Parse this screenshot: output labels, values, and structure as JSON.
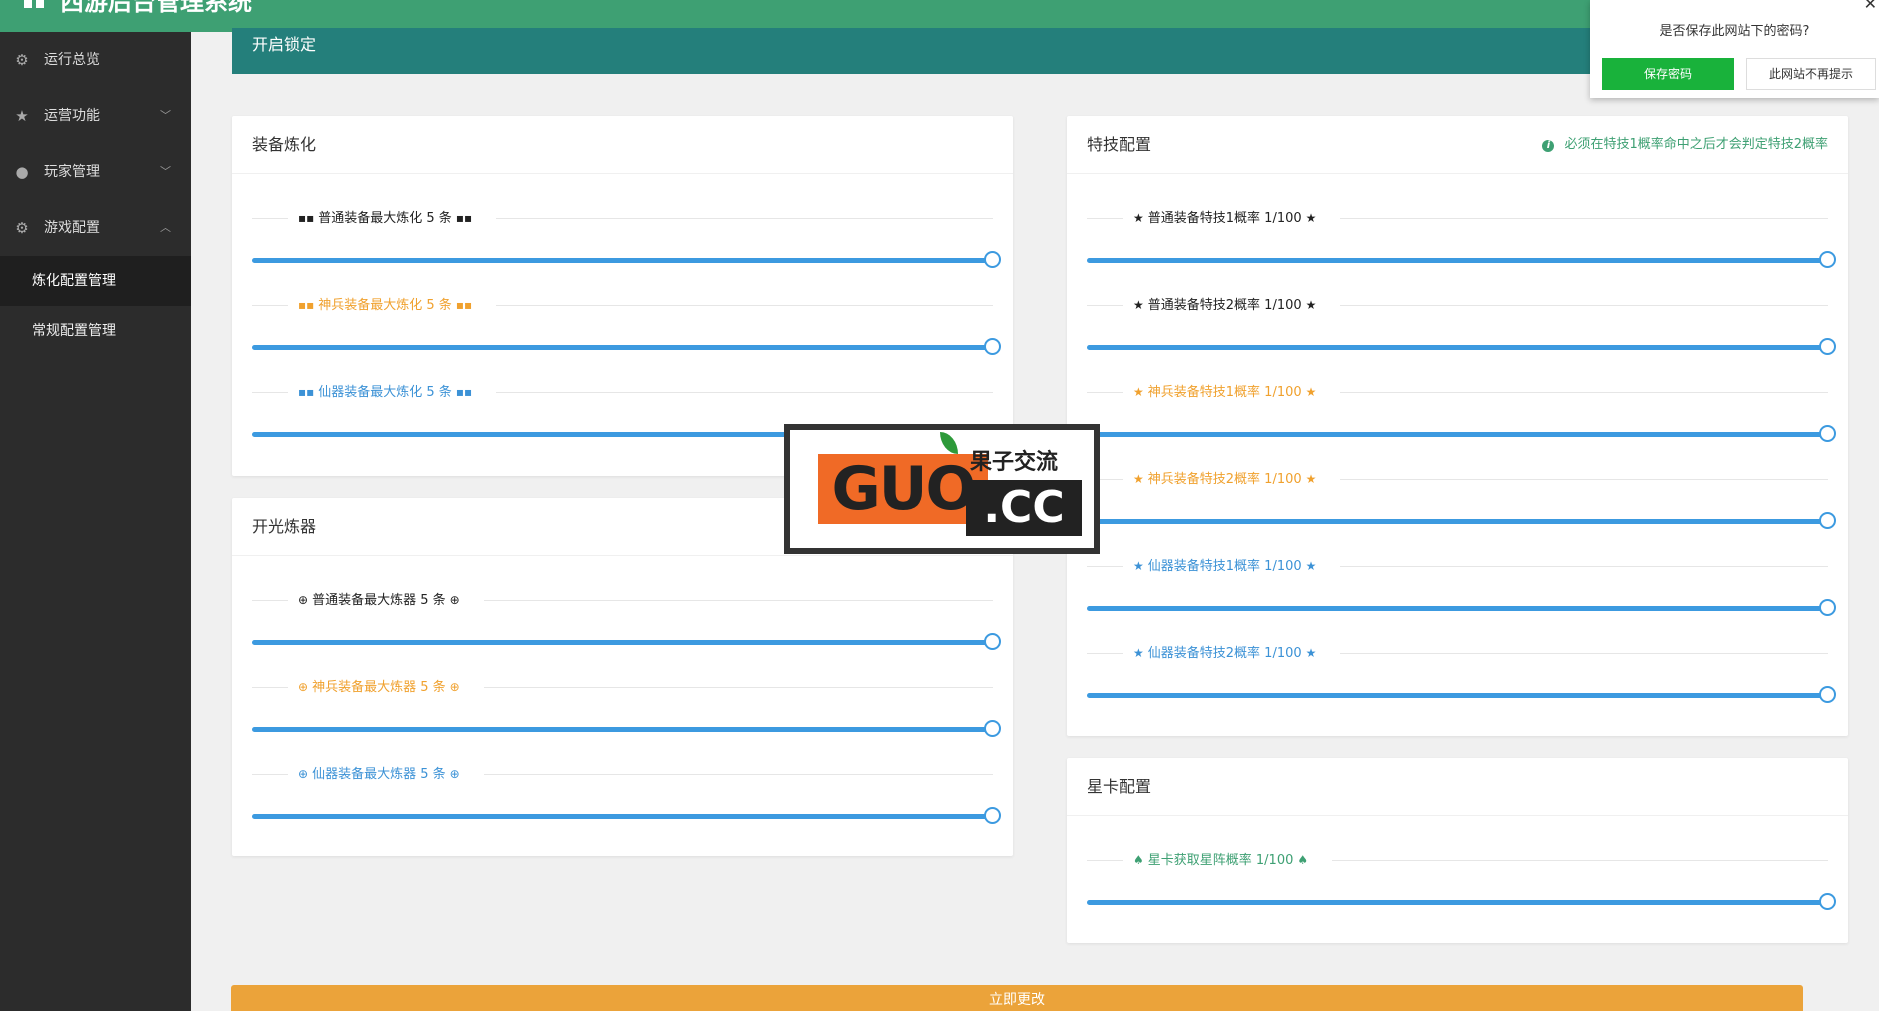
{
  "app": {
    "title": "西游后台管理系统"
  },
  "sidebar": {
    "items": [
      {
        "label": "运行总览",
        "icon": "settings-ring-icon",
        "has_children": false
      },
      {
        "label": "运营功能",
        "icon": "star-icon",
        "has_children": true
      },
      {
        "label": "玩家管理",
        "icon": "user-icon",
        "has_children": true
      },
      {
        "label": "游戏配置",
        "icon": "gear-icon",
        "has_children": true,
        "expanded": true
      }
    ],
    "subitems": [
      {
        "label": "炼化配置管理",
        "active": true
      },
      {
        "label": "常规配置管理",
        "active": false
      }
    ]
  },
  "lock_bar": {
    "label": "开启锁定"
  },
  "refine_card": {
    "title": "装备炼化",
    "rows": [
      {
        "label": "普通装备最大炼化 5 条",
        "color": "#222222",
        "icon": "grid-icon",
        "value": 5,
        "max": 5
      },
      {
        "label": "神兵装备最大炼化 5 条",
        "color": "#f0a12e",
        "icon": "grid-icon",
        "value": 5,
        "max": 5
      },
      {
        "label": "仙器装备最大炼化 5 条",
        "color": "#3c92d6",
        "icon": "grid-icon",
        "value": 5,
        "max": 5
      }
    ]
  },
  "forge_card": {
    "title": "开光炼器",
    "rows": [
      {
        "label": "普通装备最大炼器 5 条",
        "color": "#222222",
        "icon": "plus-circle-icon",
        "value": 5,
        "max": 5
      },
      {
        "label": "神兵装备最大炼器 5 条",
        "color": "#f0a12e",
        "icon": "plus-circle-icon",
        "value": 5,
        "max": 5
      },
      {
        "label": "仙器装备最大炼器 5 条",
        "color": "#3c92d6",
        "icon": "plus-circle-icon",
        "value": 5,
        "max": 5
      }
    ]
  },
  "skill_card": {
    "title": "特技配置",
    "hint": "必须在特技1概率命中之后才会判定特技2概率",
    "rows": [
      {
        "label": "普通装备特技1概率 1/100",
        "color": "#222222",
        "icon": "star-icon",
        "value": 100,
        "max": 100
      },
      {
        "label": "普通装备特技2概率 1/100",
        "color": "#222222",
        "icon": "star-icon",
        "value": 100,
        "max": 100
      },
      {
        "label": "神兵装备特技1概率 1/100",
        "color": "#f0a12e",
        "icon": "star-icon",
        "value": 100,
        "max": 100
      },
      {
        "label": "神兵装备特技2概率 1/100",
        "color": "#f0a12e",
        "icon": "star-icon",
        "value": 100,
        "max": 100
      },
      {
        "label": "仙器装备特技1概率 1/100",
        "color": "#3c92d6",
        "icon": "star-icon",
        "value": 100,
        "max": 100
      },
      {
        "label": "仙器装备特技2概率 1/100",
        "color": "#3c92d6",
        "icon": "star-icon",
        "value": 100,
        "max": 100
      }
    ]
  },
  "star_card": {
    "title": "星卡配置",
    "rows": [
      {
        "label": "星卡获取星阵概率 1/100",
        "color": "#3ea073",
        "icon": "bell-icon",
        "value": 100,
        "max": 100
      }
    ]
  },
  "submit": {
    "label": "立即更改"
  },
  "password_popup": {
    "title": "是否保存此网站下的密码?",
    "save_label": "保存密码",
    "never_label": "此网站不再提示"
  },
  "watermark": {
    "brand": "GUO",
    "suffix": ".CC",
    "cn": "果子交流"
  },
  "colors": {
    "topbar": "#3ea073",
    "sidebar": "#2c2c2c",
    "slider": "#3c9ae0",
    "submit": "#eba33a"
  }
}
